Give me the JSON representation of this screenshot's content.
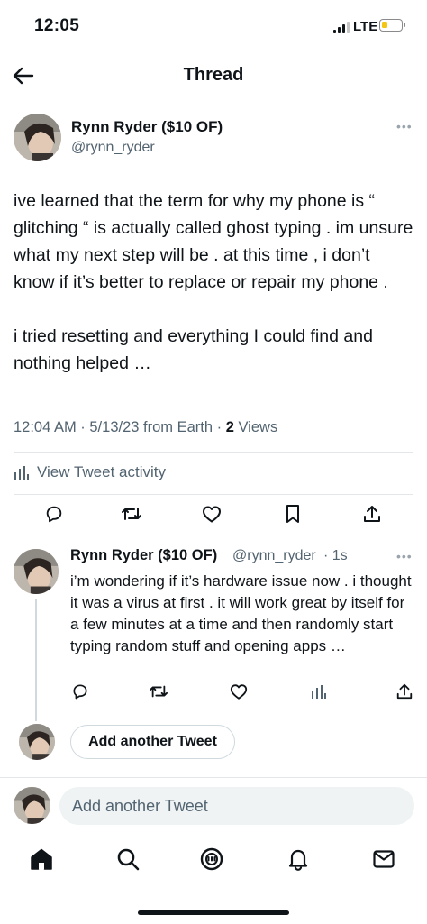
{
  "status_bar": {
    "time": "12:05",
    "network": "LTE",
    "battery_level_percent": 20,
    "battery_color": "#f3c614"
  },
  "header": {
    "title": "Thread"
  },
  "main_tweet": {
    "author_name": "Rynn Ryder ($10 OF)",
    "author_handle": "@rynn_ryder",
    "paragraphs": [
      "ive learned that the term for why my phone is “ glitching “ is actually called ghost typing . im unsure what my next step will be . at this time , i don’t know if it’s better to replace or repair my phone .",
      "i tried resetting and everything I could find and nothing helped …"
    ],
    "meta": "12:04 AM · 5/13/23 from Earth · ",
    "views_count": "2",
    "views_label": " Views",
    "activity_label": "View Tweet activity"
  },
  "reply": {
    "author_name": "Rynn Ryder ($10 OF)",
    "author_handle": "@rynn_ryder",
    "time": "· 1s",
    "text": "i’m wondering if it’s hardware issue now . i thought it was a virus at first . it will work great by itself for a few minutes at a time and then randomly start typing random stuff and opening apps …"
  },
  "add_tweet_button": "Add another Tweet",
  "compose": {
    "placeholder": "Add another Tweet"
  },
  "tab_bar": [
    "home-icon",
    "search-icon",
    "communities-icon",
    "notifications-icon",
    "messages-icon"
  ],
  "colors": {
    "text": "#0f1419",
    "secondary": "#536471",
    "divider": "#e3e7ea"
  }
}
